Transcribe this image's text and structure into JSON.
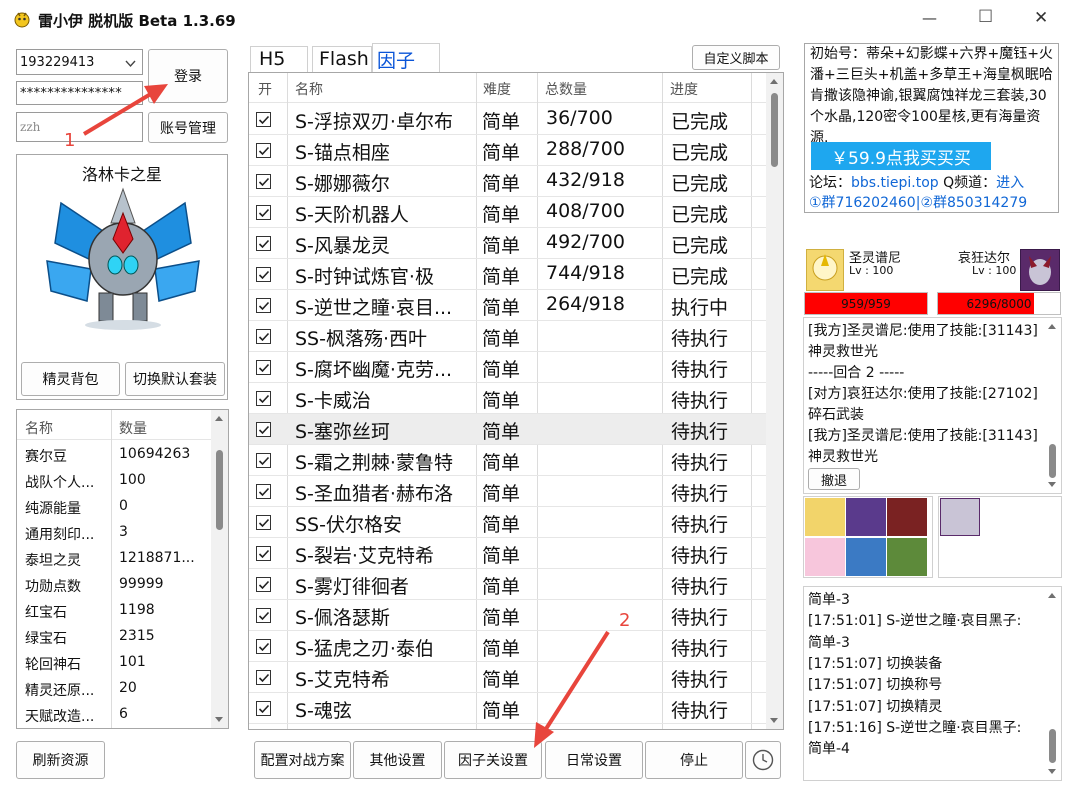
{
  "window": {
    "title": "雷小伊 脱机版 Beta 1.3.69",
    "controls": {
      "minimize": "—",
      "maximize": "☐",
      "close": "✕"
    }
  },
  "login": {
    "account": "193229413",
    "password": "***************",
    "alias_placeholder": "zzh",
    "login_button": "登录",
    "account_manage_button": "账号管理"
  },
  "annotations": {
    "marker1": "1",
    "marker2": "2",
    "arrow_color": "#e8453c"
  },
  "sprite": {
    "name": "洛林卡之星",
    "bag_button": "精灵背包",
    "switch_suit_button": "切换默认套装"
  },
  "resources": {
    "headers": [
      "名称",
      "数量"
    ],
    "rows": [
      [
        "赛尔豆",
        "10694263"
      ],
      [
        "战队个人...",
        "100"
      ],
      [
        "纯源能量",
        "0"
      ],
      [
        "通用刻印...",
        "3"
      ],
      [
        "泰坦之灵",
        "1218871..."
      ],
      [
        "功勋点数",
        "99999"
      ],
      [
        "红宝石",
        "1198"
      ],
      [
        "绿宝石",
        "2315"
      ],
      [
        "轮回神石",
        "101"
      ],
      [
        "精灵还原...",
        "20"
      ],
      [
        "天赋改造...",
        "6"
      ]
    ],
    "refresh_button": "刷新资源"
  },
  "tabs": {
    "items": [
      "H5",
      "Flash",
      "因子"
    ],
    "active_index": 2,
    "custom_script_button": "自定义脚本"
  },
  "tasks": {
    "headers": [
      "开",
      "名称",
      "难度",
      "总数量",
      "进度"
    ],
    "rows": [
      {
        "name": "S-浮掠双刃·卓尔布",
        "difficulty": "简单",
        "count": "36/700",
        "status": "已完成",
        "checked": true
      },
      {
        "name": "S-锚点相座",
        "difficulty": "简单",
        "count": "288/700",
        "status": "已完成",
        "checked": true
      },
      {
        "name": "S-娜娜薇尔",
        "difficulty": "简单",
        "count": "432/918",
        "status": "已完成",
        "checked": true
      },
      {
        "name": "S-天阶机器人",
        "difficulty": "简单",
        "count": "408/700",
        "status": "已完成",
        "checked": true
      },
      {
        "name": "S-风暴龙灵",
        "difficulty": "简单",
        "count": "492/700",
        "status": "已完成",
        "checked": true
      },
      {
        "name": "S-时钟试炼官·极",
        "difficulty": "简单",
        "count": "744/918",
        "status": "已完成",
        "checked": true
      },
      {
        "name": "S-逆世之瞳·哀目...",
        "difficulty": "简单",
        "count": "264/918",
        "status": "执行中",
        "checked": true
      },
      {
        "name": "SS-枫落殇·西叶",
        "difficulty": "简单",
        "count": "",
        "status": "待执行",
        "checked": true
      },
      {
        "name": "S-腐坏幽魔·克劳...",
        "difficulty": "简单",
        "count": "",
        "status": "待执行",
        "checked": true
      },
      {
        "name": "S-卡威治",
        "difficulty": "简单",
        "count": "",
        "status": "待执行",
        "checked": true
      },
      {
        "name": "S-塞弥丝珂",
        "difficulty": "简单",
        "count": "",
        "status": "待执行",
        "checked": true
      },
      {
        "name": "S-霜之荆棘·蒙鲁特",
        "difficulty": "简单",
        "count": "",
        "status": "待执行",
        "checked": true
      },
      {
        "name": "S-圣血猎者·赫布洛",
        "difficulty": "简单",
        "count": "",
        "status": "待执行",
        "checked": true
      },
      {
        "name": "SS-伏尔格安",
        "difficulty": "简单",
        "count": "",
        "status": "待执行",
        "checked": true
      },
      {
        "name": "S-裂岩·艾克特希",
        "difficulty": "简单",
        "count": "",
        "status": "待执行",
        "checked": true
      },
      {
        "name": "S-雾灯徘徊者",
        "difficulty": "简单",
        "count": "",
        "status": "待执行",
        "checked": true
      },
      {
        "name": "S-佩洛瑟斯",
        "difficulty": "简单",
        "count": "",
        "status": "待执行",
        "checked": true
      },
      {
        "name": "S-猛虎之刃·泰伯",
        "difficulty": "简单",
        "count": "",
        "status": "待执行",
        "checked": true
      },
      {
        "name": "S-艾克特希",
        "difficulty": "简单",
        "count": "",
        "status": "待执行",
        "checked": true
      },
      {
        "name": "S-魂弦",
        "difficulty": "简单",
        "count": "",
        "status": "待执行",
        "checked": true
      }
    ]
  },
  "bottom_buttons": {
    "battle_plan": "配置对战方案",
    "other_settings": "其他设置",
    "factor_settings": "因子关设置",
    "daily_settings": "日常设置",
    "stop": "停止"
  },
  "promo": {
    "text": "初始号：蒂朵+幻影蝶+六界+魔钰+火潘+三巨头+机盖+多草王+海皇枫眠哈肯撒该隐神谕,银翼腐蚀祥龙三套装,30个水晶,120密令100星核,更有海量资源.",
    "buy_button": "￥59.9点我买买买",
    "buy_color": "#1ea7ef",
    "forum_label": "论坛：",
    "forum_url": "bbs.tiepi.top",
    "qq_channel_label": " Q频道：",
    "qq_channel_link": "进入",
    "group1": "①群716202460",
    "group_sep": "|",
    "group2": "②群850314279"
  },
  "battle": {
    "mine": {
      "name": "圣灵谱尼",
      "level": "Lv : 100",
      "hp": "959/959",
      "hp_fraction": 1.0
    },
    "enemy": {
      "name": "哀狂达尔",
      "level": "Lv : 100",
      "hp": "6296/8000",
      "hp_fraction": 0.787
    },
    "hp_color": "#ff0000",
    "log": [
      "[我方]圣灵谱尼:使用了技能:[31143]",
      "神灵救世光",
      "-----回合 2 -----",
      "[对方]哀狂达尔:使用了技能:[27102]",
      "碎石武装",
      "[我方]圣灵谱尼:使用了技能:[31143]",
      "神灵救世光"
    ],
    "retreat_button": "撤退"
  },
  "run_log": [
    "简单-3",
    "[17:51:01] S-逆世之瞳·哀目黑子:",
    "简单-3",
    "[17:51:07] 切换装备",
    "[17:51:07] 切换称号",
    "[17:51:07] 切换精灵",
    "[17:51:16] S-逆世之瞳·哀目黑子:",
    "简单-4"
  ]
}
